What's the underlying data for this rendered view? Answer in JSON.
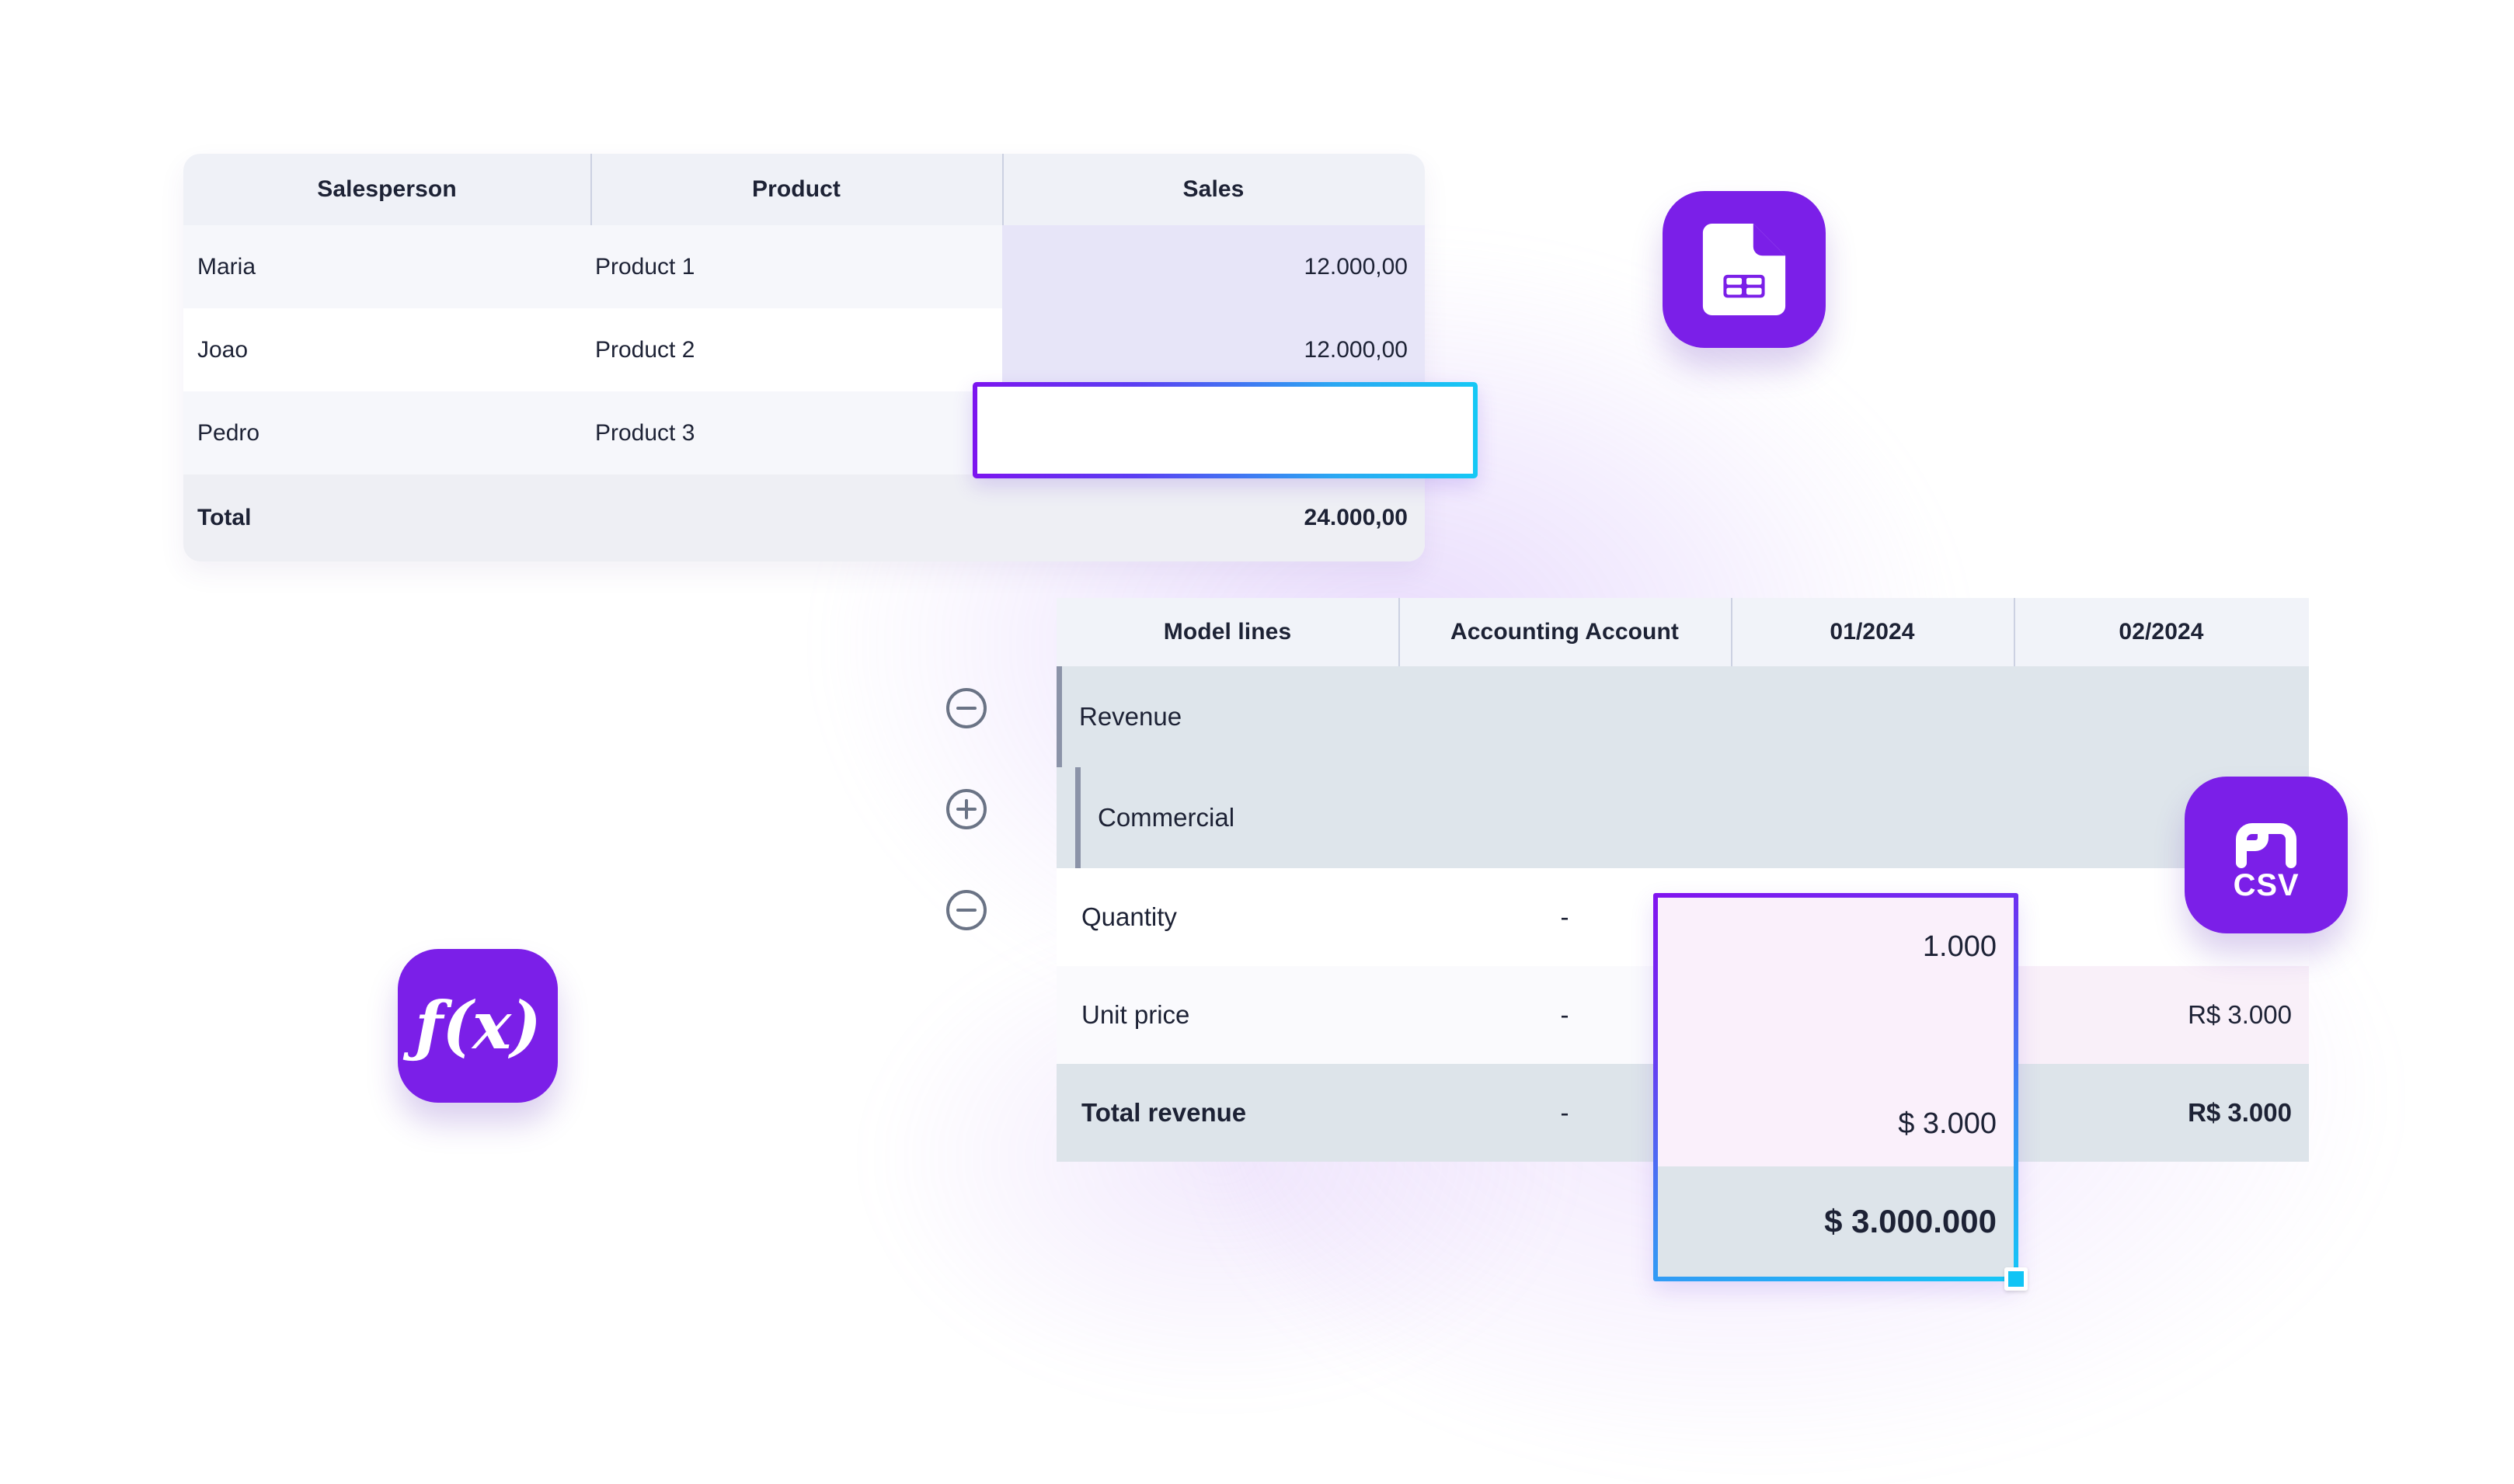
{
  "theme": {
    "accent_purple": "#7b1fe8",
    "accent_cyan": "#14c8f7",
    "text_dark": "#1d2235",
    "header_bg": "#eff1f7",
    "sales_col_tint": "#e7e5f8",
    "group_row_bg": "#dee5eb",
    "total_row_bg": "#dde4ea",
    "selection_fill": "#faf0fb",
    "canvas_bg": "#ffffff"
  },
  "sales_table": {
    "columns": [
      "Salesperson",
      "Product",
      "Sales"
    ],
    "rows": [
      {
        "salesperson": "Maria",
        "product": "Product 1",
        "sales": "12.000,00"
      },
      {
        "salesperson": "Joao",
        "product": "Product 2",
        "sales": "12.000,00"
      },
      {
        "salesperson": "Pedro",
        "product": "Product 3",
        "sales": ""
      }
    ],
    "total": {
      "label": "Total",
      "value": "24.000,00"
    },
    "editing_cell": {
      "row": "Pedro",
      "column": "Sales",
      "value": "",
      "caret_visible": true
    }
  },
  "model_table": {
    "columns": [
      "Model lines",
      "Accounting Account",
      "01/2024",
      "02/2024"
    ],
    "rows": [
      {
        "toggle": "collapse-icon",
        "label": "Revenue",
        "level": 0,
        "accounting_account": "",
        "m01": "",
        "m02": ""
      },
      {
        "toggle": "expand-icon",
        "label": "Commercial",
        "level": 1,
        "accounting_account": "",
        "m01": "",
        "m02": ""
      },
      {
        "toggle": "collapse-icon",
        "label": "Quantity",
        "level": 1,
        "accounting_account": "-",
        "m01": "1.000",
        "m02": ""
      },
      {
        "toggle": "",
        "label": "Unit price",
        "level": 1,
        "accounting_account": "-",
        "m01": "$ 3.000",
        "m02": "R$ 3.000"
      },
      {
        "toggle": "",
        "label": "Total revenue",
        "level": 1,
        "accounting_account": "-",
        "m01": "$ 3.000.000",
        "m02": "R$ 3.000",
        "bold": true
      }
    ],
    "selection": {
      "column": "01/2024",
      "values": [
        "1.000",
        "$ 3.000",
        "$ 3.000.000"
      ],
      "resize_handle": true
    }
  },
  "icons": [
    {
      "name": "spreadsheet-file-icon",
      "label": "",
      "glyph": "spreadsheet"
    },
    {
      "name": "formula-fx-icon",
      "label": "ƒ(x)",
      "glyph": "fx"
    },
    {
      "name": "csv-file-icon",
      "label": "CSV",
      "glyph": "csv"
    }
  ]
}
